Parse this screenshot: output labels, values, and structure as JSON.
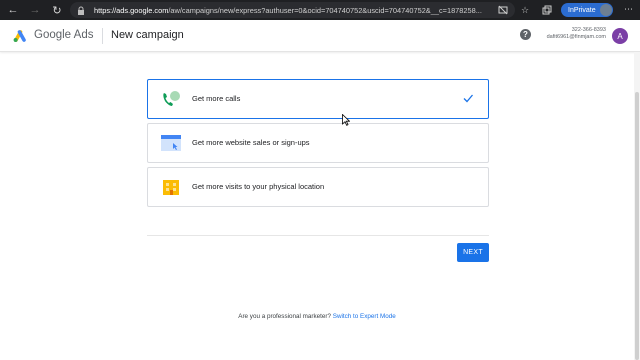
{
  "browser": {
    "url_host": "https://ads.google.com",
    "url_path": "/aw/campaigns/new/express?authuser=0&ocid=704740752&uscid=704740752&__c=1878258...",
    "inprivate_label": "InPrivate"
  },
  "header": {
    "brand": "Google Ads",
    "page_title": "New campaign",
    "account_phone": "322-366-8393",
    "account_email": "dafit6961@finmjam.com",
    "avatar_initial": "A"
  },
  "goals": [
    {
      "label": "Get more calls",
      "selected": true
    },
    {
      "label": "Get more website sales or sign-ups",
      "selected": false
    },
    {
      "label": "Get more visits to your physical location",
      "selected": false
    }
  ],
  "next_label": "NEXT",
  "footer": {
    "question": "Are you a professional marketer?",
    "link": "Switch to Expert Mode"
  },
  "colors": {
    "accent": "#1a73e8",
    "browser_bar": "#1f2023",
    "inprivate": "#2b6cd1",
    "avatar": "#7b3fa6"
  }
}
